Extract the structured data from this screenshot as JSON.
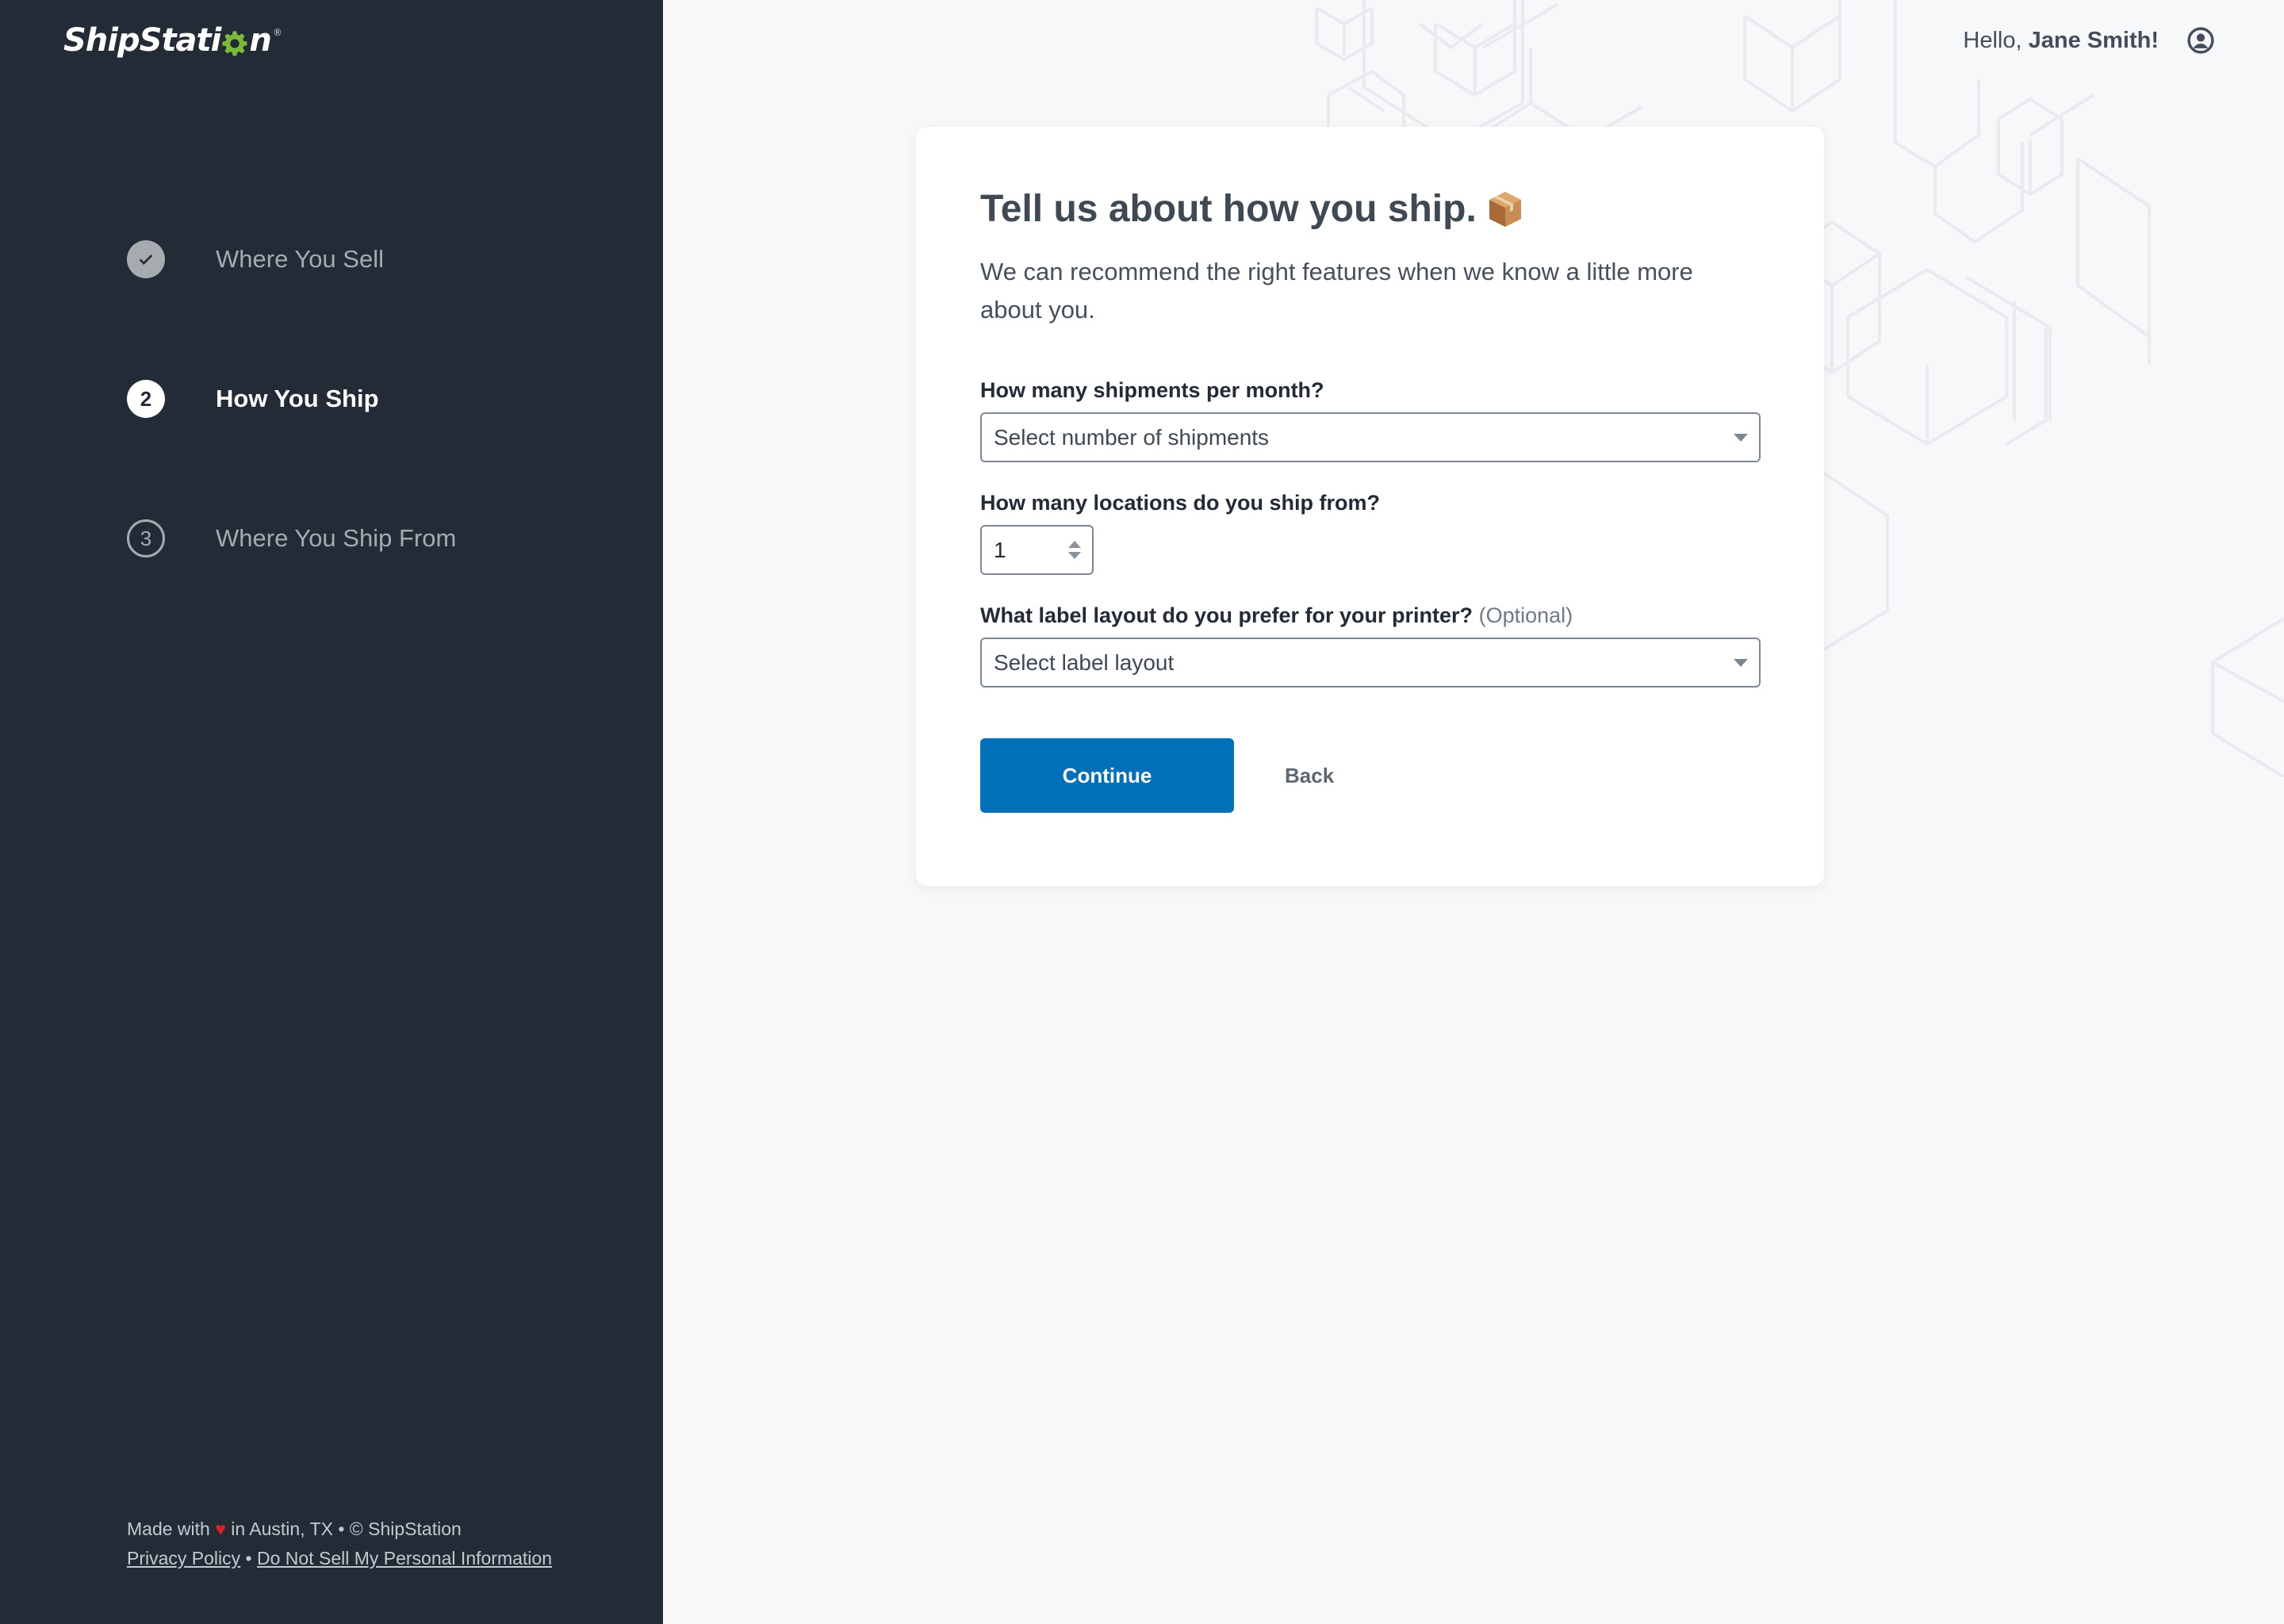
{
  "brand": {
    "name_left": "ShipStati",
    "name_right": "n",
    "registered": "®",
    "accent_color": "#7dba3a"
  },
  "sidebar": {
    "steps": [
      {
        "number": "1",
        "label": "Where You Sell",
        "state": "completed",
        "icon": "check-icon"
      },
      {
        "number": "2",
        "label": "How You Ship",
        "state": "current"
      },
      {
        "number": "3",
        "label": "Where You Ship From",
        "state": "upcoming"
      }
    ],
    "footer": {
      "made_with_prefix": "Made with",
      "heart": "♥",
      "made_with_suffix": "in Austin, TX • © ShipStation",
      "privacy_link": "Privacy Policy",
      "separator": "•",
      "do_not_sell_link": "Do Not Sell My Personal Information"
    }
  },
  "header": {
    "greeting_prefix": "Hello,",
    "user_name": "Jane Smith!",
    "user_icon": "user-circle-icon"
  },
  "card": {
    "title": "Tell us about how you ship.",
    "title_emoji": "package-icon",
    "subtitle": "We can recommend the right features when we know a little more about you.",
    "fields": {
      "shipments": {
        "label": "How many shipments per month?",
        "placeholder": "Select number of shipments",
        "value": ""
      },
      "locations": {
        "label": "How many locations do you ship from?",
        "value": "1"
      },
      "label_layout": {
        "label": "What label layout do you prefer for your printer?",
        "optional": "(Optional)",
        "placeholder": "Select label layout",
        "value": ""
      }
    },
    "continue_label": "Continue",
    "back_label": "Back"
  },
  "colors": {
    "sidebar_bg": "#222b36",
    "primary": "#0070bb",
    "page_bg": "#f7f8fa"
  }
}
